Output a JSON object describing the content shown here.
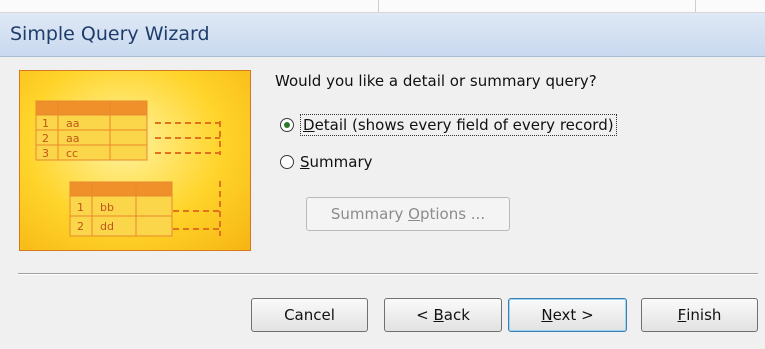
{
  "window": {
    "title": "Simple Query Wizard"
  },
  "wizard": {
    "question": "Would you like a detail or summary query?",
    "options": [
      {
        "label_prefix": "",
        "mnemonic": "D",
        "label_rest": "etail (shows every field of every record)",
        "selected": true
      },
      {
        "label_prefix": "",
        "mnemonic": "S",
        "label_rest": "ummary",
        "selected": false
      }
    ],
    "summary_options_button": {
      "prefix": "Summary ",
      "mnemonic": "O",
      "rest": "ptions ...",
      "enabled": false
    }
  },
  "illustration": {
    "table1": [
      [
        "1",
        "aa"
      ],
      [
        "2",
        "aa"
      ],
      [
        "3",
        "cc"
      ]
    ],
    "table2": [
      [
        "1",
        "bb"
      ],
      [
        "2",
        "dd"
      ]
    ]
  },
  "buttons": {
    "cancel": {
      "label": "Cancel"
    },
    "back": {
      "prefix": "< ",
      "mnemonic": "B",
      "rest": "ack"
    },
    "next": {
      "prefix": "",
      "mnemonic": "N",
      "rest": "ext >"
    },
    "finish": {
      "prefix": "",
      "mnemonic": "F",
      "rest": "inish"
    }
  },
  "colors": {
    "accent_orange": "#e2711d",
    "radio_selected": "#2a7a2a",
    "title_text": "#1e3d6b"
  }
}
